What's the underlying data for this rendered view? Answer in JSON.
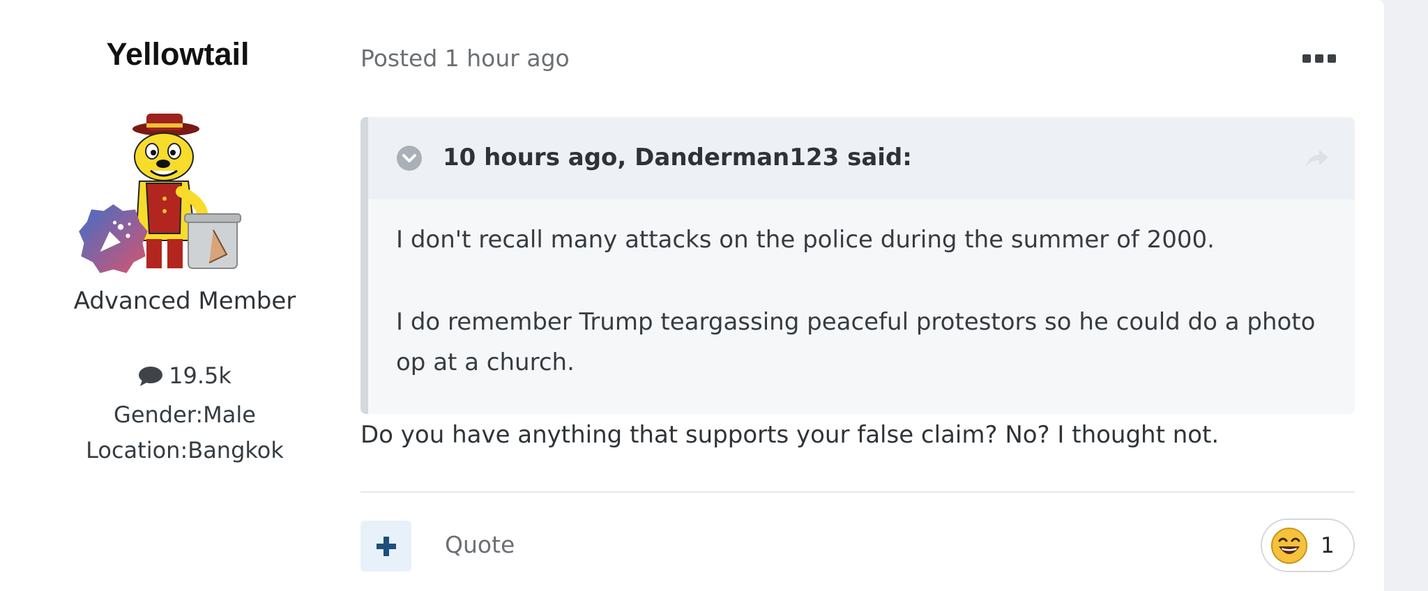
{
  "author": {
    "name": "Yellowtail",
    "rank": "Advanced Member",
    "post_count": "19.5k",
    "gender": "Gender:Male",
    "location": "Location:Bangkok"
  },
  "post": {
    "meta": "Posted 1 hour ago",
    "quote": {
      "citation": "10 hours ago, Danderman123 said:",
      "paragraphs": [
        "I don't recall many attacks on the police during the summer of 2000.",
        "I do remember Trump teargassing peaceful protestors so he could do a photo op at a church."
      ]
    },
    "text": "Do you have anything that supports your false claim? No? I thought not."
  },
  "actions": {
    "quote_label": "Quote",
    "reaction_count": "1"
  },
  "colors": {
    "accent": "#1d4f7a",
    "quote_border": "#d4d9de",
    "quote_header_bg": "#edf1f5"
  },
  "icons": {
    "more": "ellipsis-icon",
    "toggle": "chevron-down-circle-icon",
    "share": "share-arrow-icon",
    "comment": "speech-bubble-icon",
    "add": "plus-icon",
    "reaction": "laughing-emoji-icon"
  }
}
